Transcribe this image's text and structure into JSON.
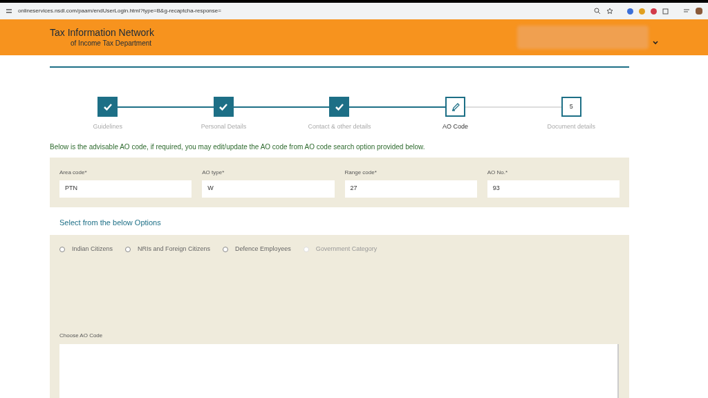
{
  "browser": {
    "url": "onlineservices.nsdl.com/paam/endUserLogin.html?type=B&g-recaptcha-response="
  },
  "header": {
    "title": "Tax Information Network",
    "subtitle": "of Income Tax Department"
  },
  "steps": [
    {
      "label": "Guidelines",
      "kind": "done",
      "selected": false
    },
    {
      "label": "Personal Details",
      "kind": "done",
      "selected": false
    },
    {
      "label": "Contact & other details",
      "kind": "done",
      "selected": false
    },
    {
      "label": "AO Code",
      "kind": "edit",
      "selected": true
    },
    {
      "label": "Document details",
      "kind": "number",
      "number": "5",
      "selected": false
    }
  ],
  "instruction": "Below is the advisable AO code, if required, you may edit/update the AO code from AO code search option provided below.",
  "fields": [
    {
      "label": "Area code*",
      "value": "PTN"
    },
    {
      "label": "AO type*",
      "value": "W"
    },
    {
      "label": "Range code*",
      "value": "27"
    },
    {
      "label": "AO No.*",
      "value": "93"
    }
  ],
  "options_title": "Select from the below Options",
  "options": [
    {
      "label": "Indian Citizens",
      "selected": false,
      "disabled": false
    },
    {
      "label": "NRIs and Foreign Citizens",
      "selected": false,
      "disabled": false
    },
    {
      "label": "Defence Employees",
      "selected": false,
      "disabled": false
    },
    {
      "label": "Government Category",
      "selected": false,
      "disabled": true
    }
  ],
  "choose_label": "Choose AO Code"
}
